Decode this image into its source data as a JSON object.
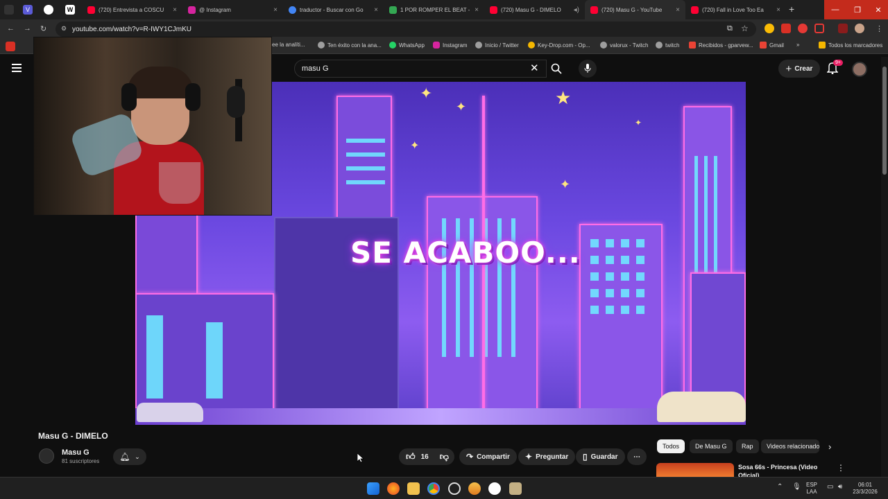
{
  "browser": {
    "tabs": [
      {
        "label": "(720) Entrevista a COSCU",
        "color": "#ff0033"
      },
      {
        "label": "@ Instagram",
        "color": "#d6249f"
      },
      {
        "label": "traductor - Buscar con Go",
        "color": "#4285f4"
      },
      {
        "label": "1 POR ROMPER EL BEAT -",
        "color": "#34a853"
      },
      {
        "label": "(720) Masu G - DIMELO",
        "color": "#ff0033"
      },
      {
        "label": "(720) Masu G - YouTube",
        "color": "#ff0033"
      },
      {
        "label": "(720) Fall in Love Too Ea",
        "color": "#ff0033"
      }
    ],
    "new_tab": "+",
    "window_controls": {
      "minimize": "—",
      "maximize": "❐",
      "close": "✕"
    },
    "url": "youtube.com/watch?v=R-IWY1CJmKU",
    "bookmarks": [
      {
        "label": "ee la analíti...",
        "color": "#9e9e9e"
      },
      {
        "label": "Ten éxito con la ana...",
        "color": "#9e9e9e"
      },
      {
        "label": "WhatsApp",
        "color": "#25d366"
      },
      {
        "label": "Instagram",
        "color": "#d6249f"
      },
      {
        "label": "Inicio / Twitter",
        "color": "#9e9e9e"
      },
      {
        "label": "Key-Drop.com - Op...",
        "color": "#f5b700"
      },
      {
        "label": "valorux - Twitch",
        "color": "#9e9e9e"
      },
      {
        "label": "twitch",
        "color": "#9e9e9e"
      },
      {
        "label": "Recibidos - gparvew...",
        "color": "#ea4335"
      },
      {
        "label": "Gmail",
        "color": "#ea4335"
      },
      {
        "label": "»",
        "color": ""
      },
      {
        "label": "Todos los marcadores",
        "color": "#f5b700"
      }
    ]
  },
  "youtube": {
    "search_value": "masu G",
    "create_label": "Crear",
    "notif_badge": "9+",
    "video": {
      "overlay_text": "SE ACABOO...",
      "title": "Masu G - DIMELO",
      "channel": "Masu G",
      "subscribers": "81 suscriptores",
      "likes": "16",
      "share_label": "Compartir",
      "ask_label": "Preguntar",
      "save_label": "Guardar"
    },
    "chips": [
      "Todos",
      "De Masu G",
      "Rap",
      "Videos relacionados"
    ],
    "recommended": [
      {
        "title": "Sosa 66s - Princesa (Video Oficial)"
      }
    ]
  },
  "taskbar": {
    "lang": "ESP",
    "lang2": "LAA",
    "time": "06:01",
    "date": "23/3/2026"
  }
}
